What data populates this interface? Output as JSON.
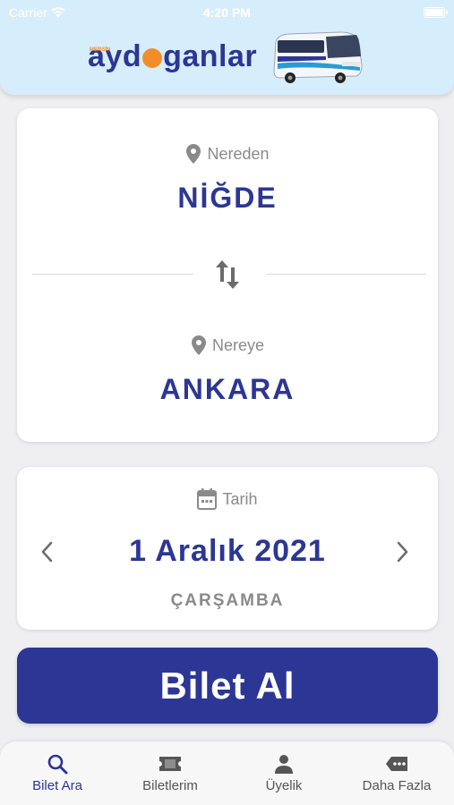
{
  "status_bar": {
    "carrier": "Carrier",
    "time": "4:20 PM"
  },
  "header": {
    "logo_text_left": "ayd",
    "logo_text_right": "ganlar",
    "logo_mini": "MERSİN"
  },
  "route": {
    "from_label": "Nereden",
    "from_city": "NİĞDE",
    "to_label": "Nereye",
    "to_city": "ANKARA"
  },
  "date": {
    "label": "Tarih",
    "value": "1 Aralık 2021",
    "weekday": "ÇARŞAMBA"
  },
  "buy_button": {
    "label": "Bilet Al"
  },
  "tabs": [
    {
      "label": "Bilet Ara",
      "icon": "search-icon",
      "active": true
    },
    {
      "label": "Biletlerim",
      "icon": "ticket-icon",
      "active": false
    },
    {
      "label": "Üyelik",
      "icon": "user-icon",
      "active": false
    },
    {
      "label": "Daha Fazla",
      "icon": "more-icon",
      "active": false
    }
  ],
  "colors": {
    "brand": "#2c3694",
    "accent": "#f28d2c",
    "header_bg": "#d6eefb",
    "muted": "#8a8a8a"
  }
}
